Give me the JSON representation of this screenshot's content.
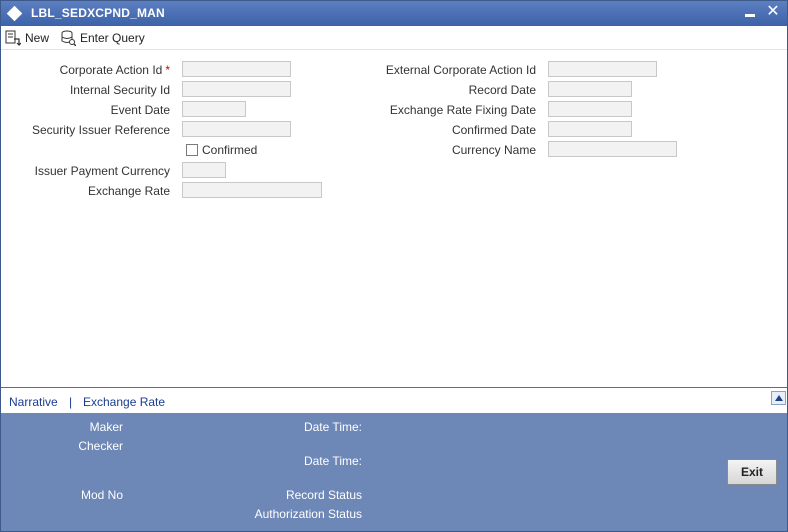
{
  "window": {
    "title": "LBL_SEDXCPND_MAN",
    "close_glyph": "✕"
  },
  "toolbar": {
    "new_label": "New",
    "enter_query_label": "Enter Query"
  },
  "form": {
    "left": {
      "corporate_action_id": {
        "label": "Corporate Action Id",
        "required_mark": "*",
        "value": ""
      },
      "internal_security_id": {
        "label": "Internal Security Id",
        "value": ""
      },
      "event_date": {
        "label": "Event Date",
        "value": ""
      },
      "security_issuer_reference": {
        "label": "Security Issuer Reference",
        "value": ""
      },
      "confirmed": {
        "label": "Confirmed",
        "checked": false
      },
      "issuer_payment_currency": {
        "label": "Issuer Payment Currency",
        "value": ""
      },
      "exchange_rate": {
        "label": "Exchange Rate",
        "value": ""
      }
    },
    "right": {
      "external_corporate_action_id": {
        "label": "External Corporate Action Id",
        "value": ""
      },
      "record_date": {
        "label": "Record Date",
        "value": ""
      },
      "exchange_rate_fixing_date": {
        "label": "Exchange Rate Fixing Date",
        "value": ""
      },
      "confirmed_date": {
        "label": "Confirmed Date",
        "value": ""
      },
      "currency_name": {
        "label": "Currency Name",
        "value": ""
      }
    }
  },
  "links": {
    "narrative": "Narrative",
    "separator": "|",
    "exchange_rate": "Exchange Rate"
  },
  "footer": {
    "maker": "Maker",
    "checker": "Checker",
    "date_time_1": "Date Time:",
    "date_time_2": "Date Time:",
    "mod_no": "Mod No",
    "record_status": "Record Status",
    "authorization_status": "Authorization Status",
    "exit_label": "Exit"
  },
  "colors": {
    "title_bar": "#4a6eb0",
    "footer_bg": "#6d87b6",
    "link": "#1a3d8f",
    "required": "#cc0000"
  },
  "icons": {
    "title": "diamond-icon",
    "minimize": "minimize-icon",
    "close": "close-icon",
    "new": "new-document-icon",
    "enter_query": "enter-query-icon",
    "scroll": "scroll-up-icon"
  }
}
